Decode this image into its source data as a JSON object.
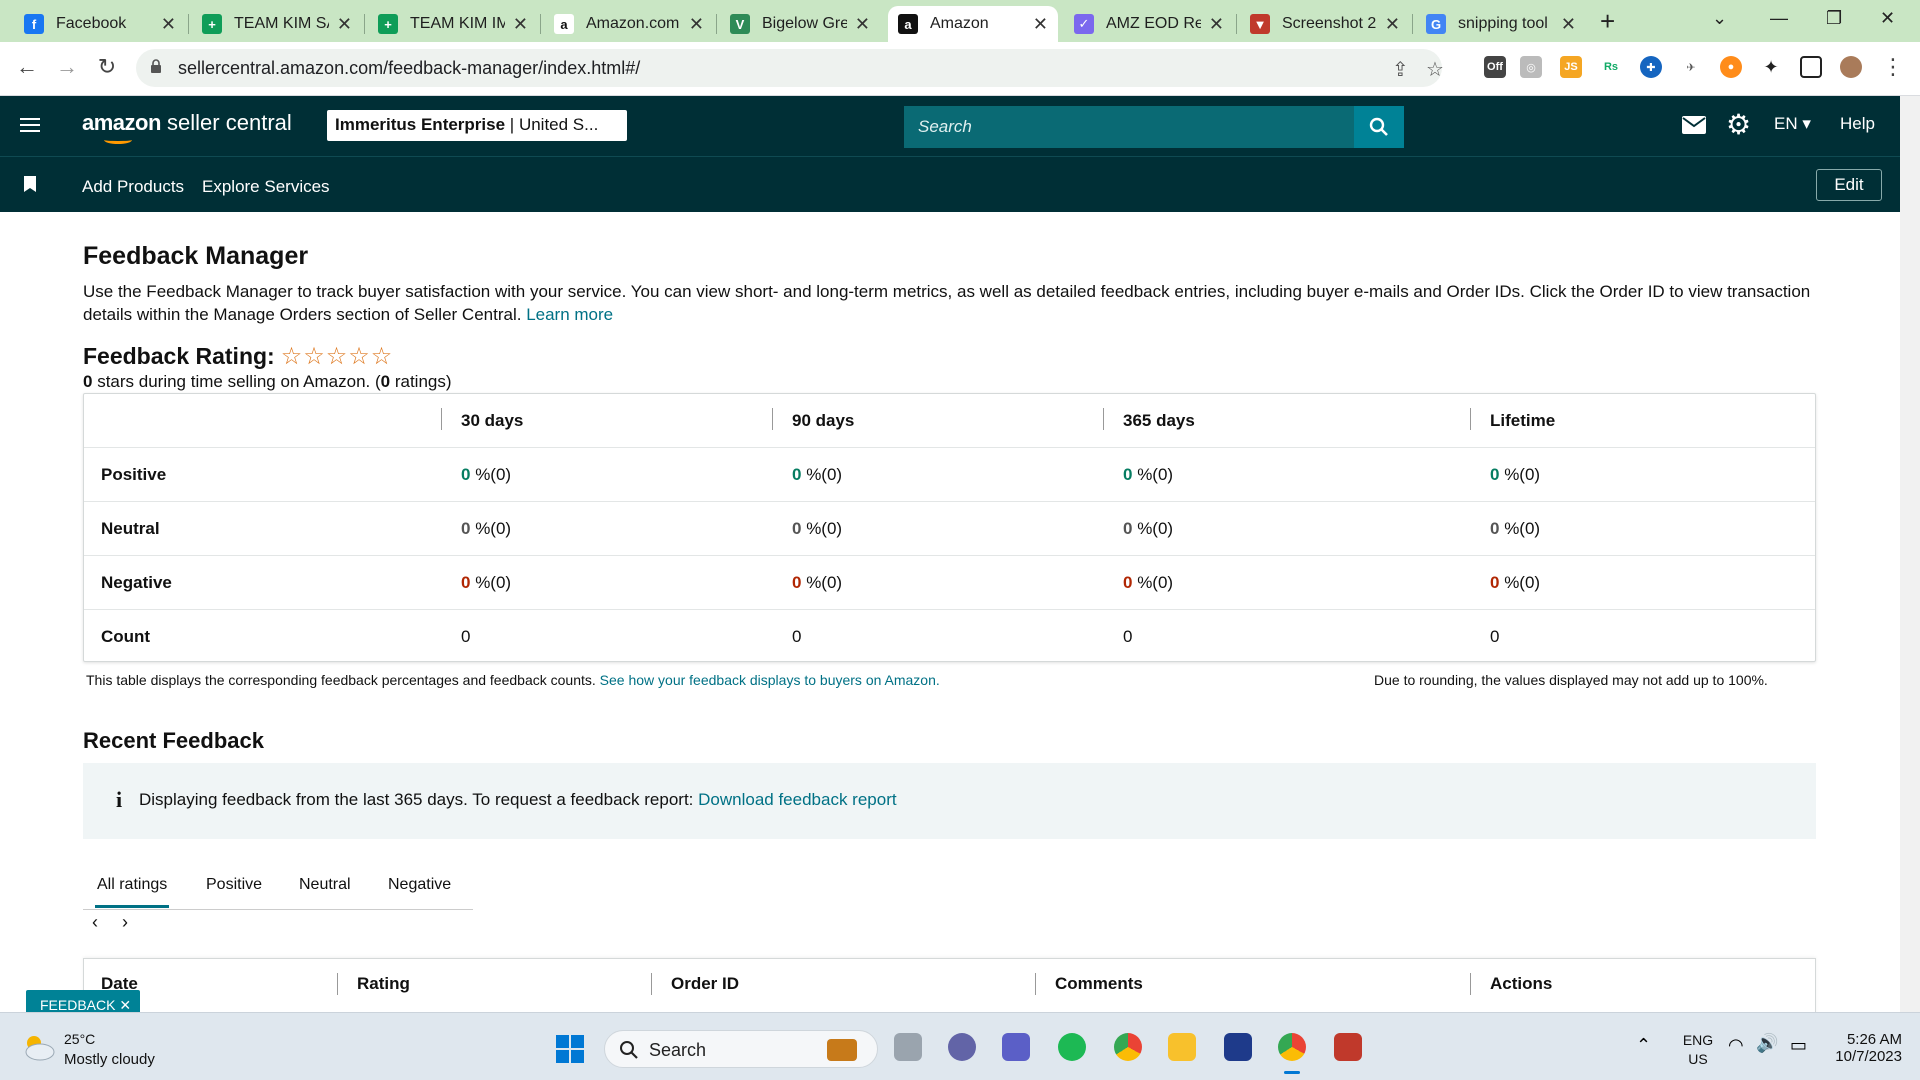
{
  "browser": {
    "tabs": [
      {
        "title": "Facebook",
        "icon": "facebook-icon",
        "color": "#1877f2",
        "glyph": "f"
      },
      {
        "title": "TEAM KIM SA",
        "icon": "sheets-icon",
        "color": "#0f9d58",
        "glyph": "+"
      },
      {
        "title": "TEAM KIM IM",
        "icon": "sheets-icon",
        "color": "#0f9d58",
        "glyph": "+"
      },
      {
        "title": "Amazon.com",
        "icon": "amazon-icon",
        "color": "#ffffff",
        "glyph": "a"
      },
      {
        "title": "Bigelow Gree",
        "icon": "bigelow-icon",
        "color": "#2e8b57",
        "glyph": "V"
      },
      {
        "title": "Amazon",
        "icon": "amazon-icon",
        "color": "#111111",
        "glyph": "a"
      },
      {
        "title": "AMZ EOD Re",
        "icon": "clickup-icon",
        "color": "#7b68ee",
        "glyph": "✓"
      },
      {
        "title": "Screenshot 2",
        "icon": "snip-icon",
        "color": "#c0392b",
        "glyph": "▼"
      },
      {
        "title": "snipping tool",
        "icon": "google-icon",
        "color": "#4285f4",
        "glyph": "G"
      }
    ],
    "new_tab": "+",
    "url": "sellercentral.amazon.com/feedback-manager/index.html#/"
  },
  "header": {
    "logo_brand": "amazon",
    "logo_product": "seller central",
    "account": "Immeritus Enterprise",
    "account_region": "United S...",
    "search_placeholder": "Search",
    "lang": "EN",
    "help": "Help"
  },
  "subnav": {
    "links": [
      "Add Products",
      "Explore Services"
    ],
    "edit": "Edit"
  },
  "page": {
    "title": "Feedback Manager",
    "description": "Use the Feedback Manager to track buyer satisfaction with your service. You can view short- and long-term metrics, as well as detailed feedback entries, including buyer e-mails and Order IDs. Click the Order ID to view transaction details within the Manage Orders section of Seller Central.",
    "learn_more": "Learn more",
    "rating_label": "Feedback Rating:",
    "stars": 0,
    "star_glyphs": "☆☆☆☆☆",
    "rating_value": "0",
    "rating_text": " stars during time selling on Amazon. (",
    "rating_count": "0",
    "rating_text_end": " ratings)"
  },
  "feedback_table": {
    "columns": [
      "30 days",
      "90 days",
      "365 days",
      "Lifetime"
    ],
    "rows": [
      {
        "label": "Positive",
        "tone": "g",
        "cells": [
          {
            "v": "0",
            "s": " %(0)"
          },
          {
            "v": "0",
            "s": " %(0)"
          },
          {
            "v": "0",
            "s": " %(0)"
          },
          {
            "v": "0",
            "s": " %(0)"
          }
        ]
      },
      {
        "label": "Neutral",
        "tone": "n",
        "cells": [
          {
            "v": "0",
            "s": " %(0)"
          },
          {
            "v": "0",
            "s": " %(0)"
          },
          {
            "v": "0",
            "s": " %(0)"
          },
          {
            "v": "0",
            "s": " %(0)"
          }
        ]
      },
      {
        "label": "Negative",
        "tone": "r",
        "cells": [
          {
            "v": "0",
            "s": " %(0)"
          },
          {
            "v": "0",
            "s": " %(0)"
          },
          {
            "v": "0",
            "s": " %(0)"
          },
          {
            "v": "0",
            "s": " %(0)"
          }
        ]
      },
      {
        "label": "Count",
        "tone": "",
        "cells": [
          {
            "v": "",
            "s": "0"
          },
          {
            "v": "",
            "s": "0"
          },
          {
            "v": "",
            "s": "0"
          },
          {
            "v": "",
            "s": "0"
          }
        ]
      }
    ],
    "note": "This table displays the corresponding feedback percentages and feedback counts.",
    "note_link": "See how your feedback displays to buyers on Amazon.",
    "rounding_note": "Due to rounding, the values displayed may not add up to 100%."
  },
  "recent": {
    "title": "Recent Feedback",
    "info_icon": "i",
    "info_text": "Displaying feedback from the last 365 days. To request a feedback report: ",
    "info_link": "Download feedback report",
    "tabs": [
      "All ratings",
      "Positive",
      "Neutral",
      "Negative"
    ],
    "active_tab": "All ratings",
    "columns": [
      "Date",
      "Rating",
      "Order ID",
      "Comments",
      "Actions"
    ]
  },
  "feedback_tag": "FEEDBACK ✕",
  "taskbar": {
    "temp": "25°C",
    "weather": "Mostly cloudy",
    "search": "Search",
    "lang_top": "ENG",
    "lang_bottom": "US",
    "time": "5:26 AM",
    "date": "10/7/2023"
  },
  "colors": {
    "header_bg": "#002f36",
    "link": "#007185",
    "positive": "#067d62",
    "negative": "#b12704",
    "star": "#de7921"
  }
}
